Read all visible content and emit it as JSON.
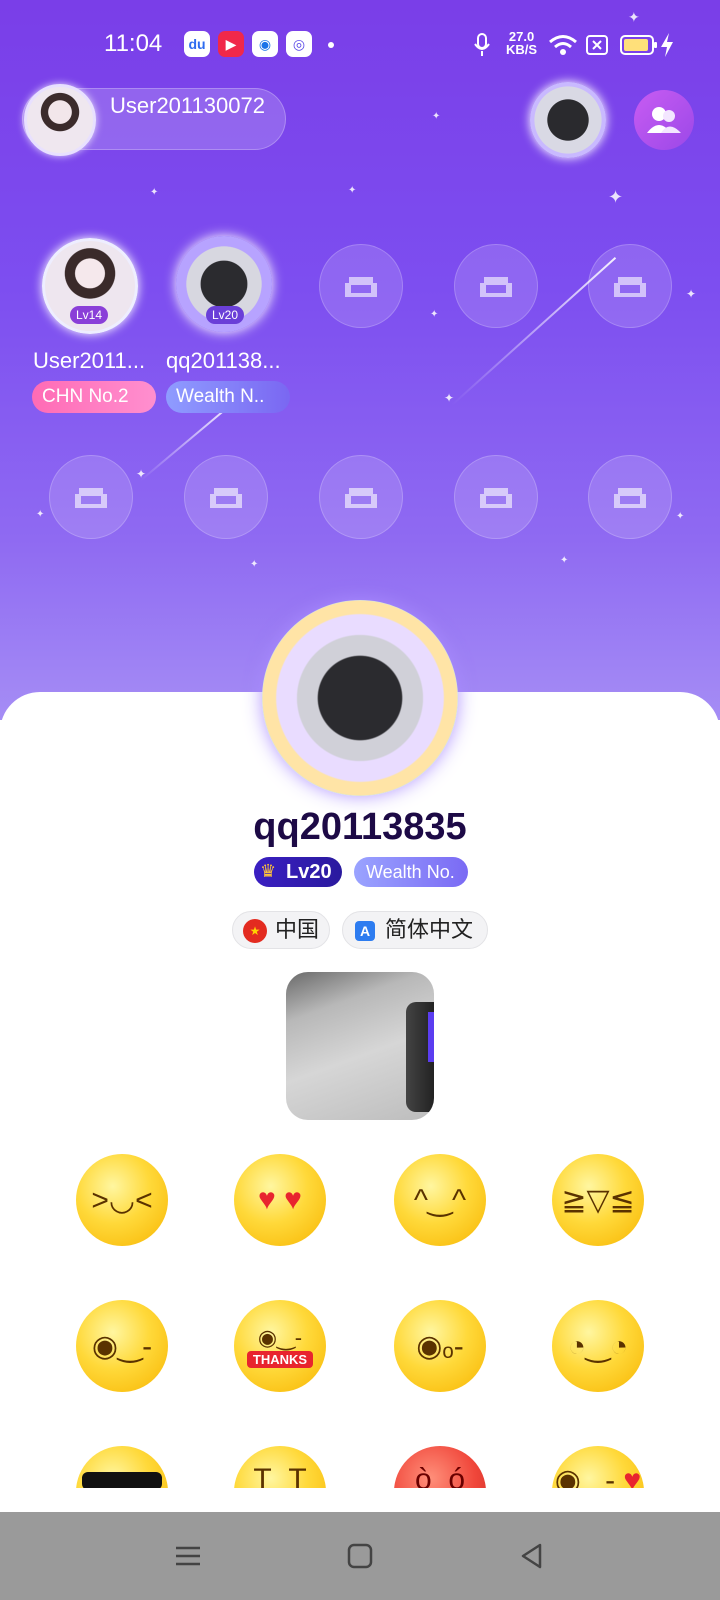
{
  "status_bar": {
    "time": "11:04",
    "net_speed_value": "27.0",
    "net_speed_unit": "KB/S",
    "icons": [
      "baidu-app-icon",
      "video-app-icon",
      "browser-app-icon",
      "camera-app-icon",
      "mic-icon",
      "wifi-icon",
      "sim-icon",
      "battery-icon",
      "charging-icon"
    ]
  },
  "room": {
    "owner_name": "User201130072",
    "seats": [
      {
        "name": "User2011...",
        "tag": "CHN No.2",
        "level": "Lv14"
      },
      {
        "name": "qq201138...",
        "tag": "Wealth N..",
        "level": "Lv20"
      }
    ],
    "empty_seat_icon": "sofa-icon"
  },
  "profile": {
    "username": "qq20113835",
    "level": "Lv20",
    "wealth_badge": "Wealth No.",
    "country": "中国",
    "language": "简体中文"
  },
  "emojis": [
    "laughing-emoji",
    "heart-eyes-emoji",
    "praying-emoji",
    "tears-of-joy-emoji",
    "toasting-emoji",
    "thanks-emoji",
    "kiss-emoji",
    "smiling-emoji",
    "sunglasses-emoji",
    "crying-emoji",
    "angry-emoji",
    "wink-heart-emoji"
  ],
  "thanks_label": "THANKS",
  "colors": {
    "room_bg": "#7a3ee8",
    "tag_pink": "#ff6bb5",
    "tag_blue": "#7a67f2",
    "level_badge": "#2a1a9e",
    "nav_bar": "#9a9a9a"
  }
}
